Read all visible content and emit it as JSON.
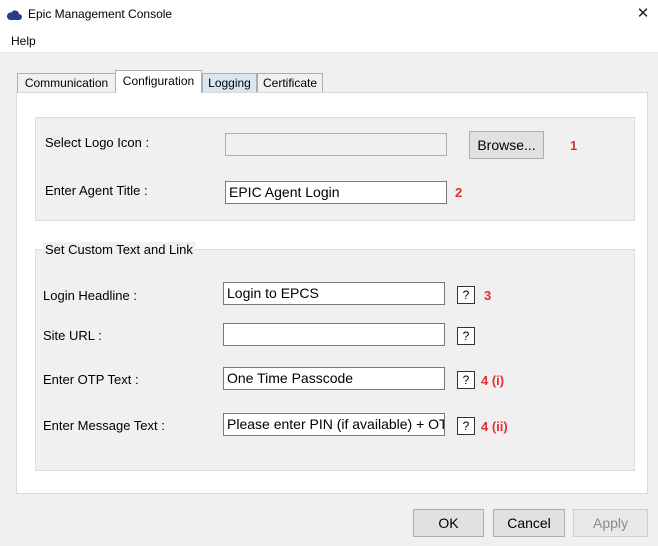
{
  "window": {
    "title": "Epic Management Console",
    "close_glyph": "✕"
  },
  "menu": {
    "help": "Help"
  },
  "tabs": [
    {
      "label": "Communication"
    },
    {
      "label": "Configuration"
    },
    {
      "label": "Logging"
    },
    {
      "label": "Certificate"
    }
  ],
  "active_tab": "Configuration",
  "logo": {
    "label": "Select Logo Icon :",
    "value": "",
    "browse_label": "Browse...",
    "marker": "1"
  },
  "agent_title": {
    "label": "Enter Agent Title :",
    "value": "EPIC Agent Login",
    "marker": "2"
  },
  "custom_group": {
    "title": "Set Custom Text and Link",
    "login_headline": {
      "label": "Login Headline :",
      "value": "Login to EPCS",
      "help": "?",
      "marker": "3"
    },
    "site_url": {
      "label": "Site URL :",
      "value": "",
      "help": "?"
    },
    "otp_text": {
      "label": "Enter OTP Text :",
      "value": "One Time Passcode",
      "help": "?",
      "marker": "4 (i)"
    },
    "message_text": {
      "label": "Enter Message Text :",
      "value": "Please enter PIN (if available) + OTP",
      "help": "?",
      "marker": "4 (ii)"
    }
  },
  "footer": {
    "ok": "OK",
    "cancel": "Cancel",
    "apply": "Apply"
  },
  "colors": {
    "marker": "#e03030",
    "tab_highlight": "#d8e6f2"
  }
}
